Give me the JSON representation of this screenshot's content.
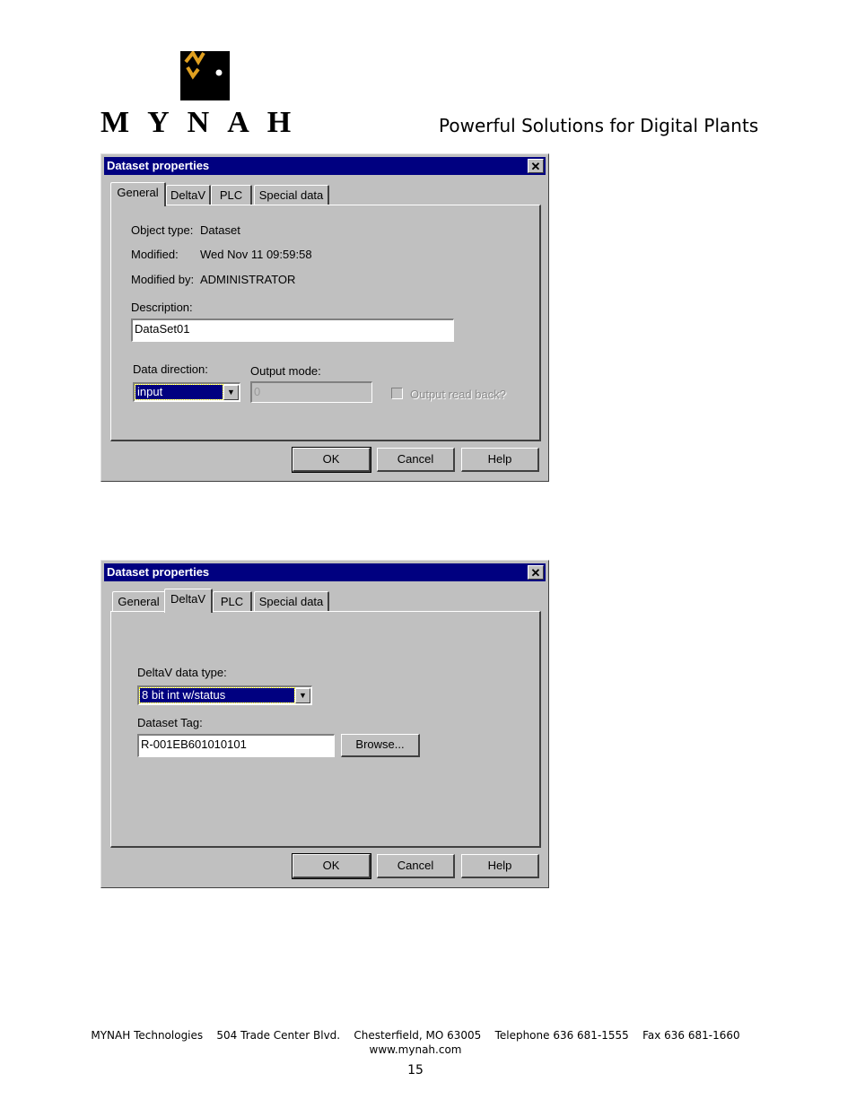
{
  "header": {
    "logo_text": "MYNAH",
    "tagline": "Powerful Solutions for Digital Plants"
  },
  "dialogs": [
    {
      "title": "Dataset properties",
      "close_glyph": "✕",
      "tabs": [
        "General",
        "DeltaV",
        "PLC",
        "Special data"
      ],
      "active_tab": "General",
      "fields": {
        "object_type_label": "Object type:",
        "object_type_value": "Dataset",
        "modified_label": "Modified:",
        "modified_value": "Wed Nov 11 09:59:58",
        "modified_by_label": "Modified by:",
        "modified_by_value": "ADMINISTRATOR",
        "description_label": "Description:",
        "description_value": "DataSet01",
        "data_direction_label": "Data direction:",
        "data_direction_value": "input",
        "output_mode_label": "Output mode:",
        "output_mode_value": "0",
        "output_read_back_label": "Output read back?"
      },
      "buttons": [
        "OK",
        "Cancel",
        "Help"
      ]
    },
    {
      "title": "Dataset properties",
      "close_glyph": "✕",
      "tabs": [
        "General",
        "DeltaV",
        "PLC",
        "Special data"
      ],
      "active_tab": "DeltaV",
      "fields": {
        "deltav_type_label": "DeltaV data type:",
        "deltav_type_value": "8 bit int w/status",
        "dataset_tag_label": "Dataset Tag:",
        "dataset_tag_value": "R-001EB601010101",
        "browse_label": "Browse..."
      },
      "buttons": [
        "OK",
        "Cancel",
        "Help"
      ]
    }
  ],
  "footer": {
    "address": "MYNAH Technologies    504 Trade Center Blvd.    Chesterfield, MO 63005    Telephone 636 681-1555    Fax 636 681-1660",
    "website": "www.mynah.com",
    "page_number": "15"
  },
  "colors": {
    "titlebar": "#000080",
    "dialog_face": "#c0c0c0",
    "logo_gold": "#e0a020"
  }
}
